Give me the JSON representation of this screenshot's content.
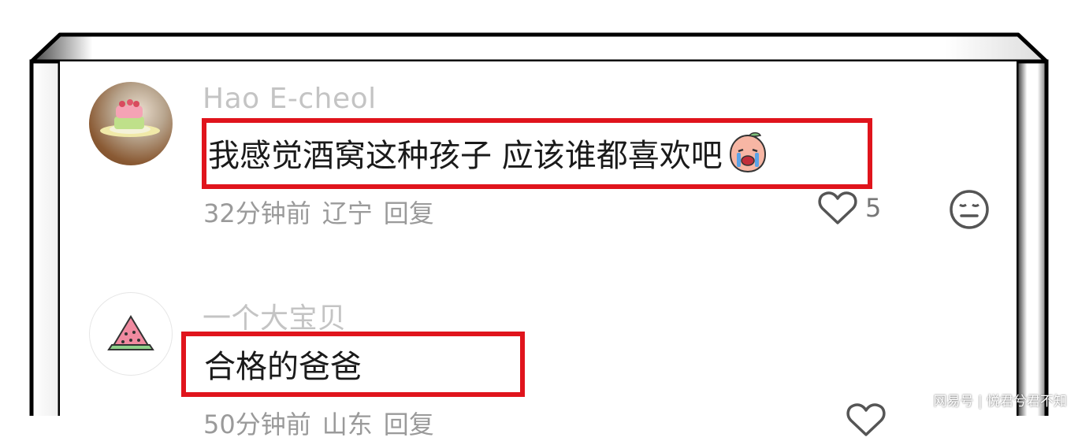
{
  "comments": [
    {
      "username": "Hao E-cheol",
      "avatar": "cake-photo-avatar",
      "text": "我感觉酒窝这种孩子 应该谁都喜欢吧",
      "emoji": "crying-peach-emoji",
      "time": "32分钟前",
      "location": "辽宁",
      "reply_label": "回复",
      "likes": "5",
      "highlight_color": "#e0141c"
    },
    {
      "username": "一个大宝贝",
      "avatar": "watermelon-avatar",
      "text": "合格的爸爸",
      "time": "50分钟前",
      "location": "山东",
      "reply_label": "回复",
      "highlight_color": "#e0141c"
    }
  ],
  "watermark": "网易号 | 悦君兮君不知"
}
